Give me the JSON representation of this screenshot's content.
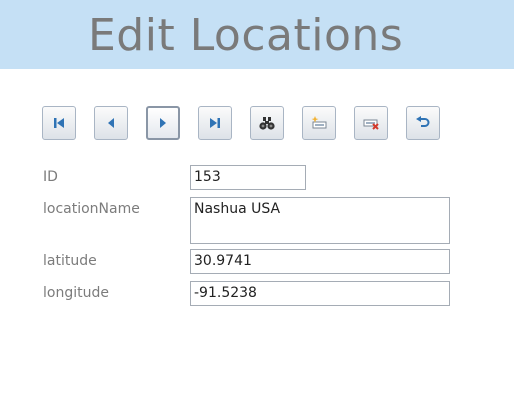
{
  "page": {
    "title": "Edit Locations"
  },
  "toolbar": {
    "buttons": [
      {
        "name": "first-record",
        "icon": "first-record-icon"
      },
      {
        "name": "previous-record",
        "icon": "previous-record-icon"
      },
      {
        "name": "next-record",
        "icon": "next-record-icon"
      },
      {
        "name": "last-record",
        "icon": "last-record-icon"
      },
      {
        "name": "find",
        "icon": "binoculars-icon"
      },
      {
        "name": "new-record",
        "icon": "new-record-icon"
      },
      {
        "name": "delete-record",
        "icon": "delete-record-icon"
      },
      {
        "name": "undo",
        "icon": "undo-icon"
      }
    ]
  },
  "form": {
    "id": {
      "label": "ID",
      "value": "153"
    },
    "locationName": {
      "label": "locationName",
      "value": "Nashua USA"
    },
    "latitude": {
      "label": "latitude",
      "value": "30.9741"
    },
    "longitude": {
      "label": "longitude",
      "value": "-91.5238"
    }
  },
  "colors": {
    "header_bg": "#c5e0f5",
    "title_text": "#7a7a7a",
    "label_text": "#7c7c7c",
    "icon_blue": "#2f73b5"
  }
}
